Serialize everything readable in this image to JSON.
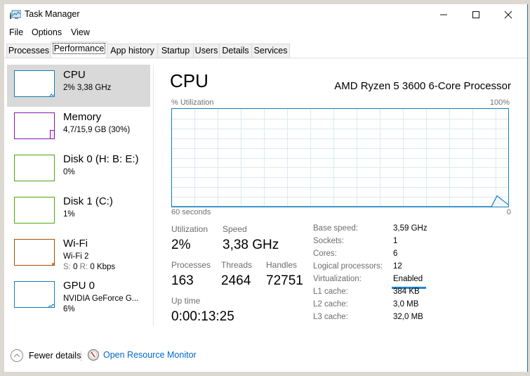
{
  "window": {
    "title": "Task Manager",
    "controls": {
      "minimize": "—",
      "maximize": "☐",
      "close": "✕"
    }
  },
  "menu": [
    "File",
    "Options",
    "View"
  ],
  "tabs": [
    {
      "label": "Processes",
      "active": false
    },
    {
      "label": "Performance",
      "active": true
    },
    {
      "label": "App history",
      "active": false
    },
    {
      "label": "Startup",
      "active": false
    },
    {
      "label": "Users",
      "active": false
    },
    {
      "label": "Details",
      "active": false
    },
    {
      "label": "Services",
      "active": false
    }
  ],
  "sidebar": {
    "items": [
      {
        "name": "CPU",
        "line1": "2% 3,38 GHz",
        "line2": "",
        "color": "#117dbb",
        "selected": true
      },
      {
        "name": "Memory",
        "line1": "4,7/15,9 GB (30%)",
        "line2": "",
        "color": "#8b12ae",
        "selected": false
      },
      {
        "name": "Disk 0 (H: B: E:)",
        "line1": "0%",
        "line2": "",
        "color": "#4da60c",
        "selected": false
      },
      {
        "name": "Disk 1 (C:)",
        "line1": "1%",
        "line2": "",
        "color": "#4da60c",
        "selected": false
      },
      {
        "name": "Wi-Fi",
        "line1": "Wi-Fi 2",
        "line2": "S: 0 R: 0 Kbps",
        "color": "#a74f01",
        "selected": false
      },
      {
        "name": "GPU 0",
        "line1": "NVIDIA GeForce G...",
        "line2": "6%",
        "color": "#117dbb",
        "selected": false
      }
    ]
  },
  "main": {
    "title": "CPU",
    "model": "AMD Ryzen 5 3600 6-Core Processor",
    "graph": {
      "ylabel": "% Utilization",
      "ymax_label": "100%",
      "xlabel_left": "60 seconds",
      "xlabel_right": "0",
      "accent": "#117dbb",
      "grid": "#d9eaf4"
    },
    "stats": {
      "utilization": {
        "label": "Utilization",
        "value": "2%"
      },
      "speed": {
        "label": "Speed",
        "value": "3,38 GHz"
      },
      "processes": {
        "label": "Processes",
        "value": "163"
      },
      "threads": {
        "label": "Threads",
        "value": "2464"
      },
      "handles": {
        "label": "Handles",
        "value": "72751"
      },
      "uptime": {
        "label": "Up time",
        "value": "0:00:13:25"
      }
    },
    "details": [
      {
        "label": "Base speed:",
        "value": "3,59 GHz"
      },
      {
        "label": "Sockets:",
        "value": "1"
      },
      {
        "label": "Cores:",
        "value": "6"
      },
      {
        "label": "Logical processors:",
        "value": "12"
      },
      {
        "label": "Virtualization:",
        "value": "Enabled"
      },
      {
        "label": "L1 cache:",
        "value": "384 KB"
      },
      {
        "label": "L2 cache:",
        "value": "3,0 MB"
      },
      {
        "label": "L3 cache:",
        "value": "32,0 MB"
      }
    ]
  },
  "chart_data": {
    "type": "area",
    "title": "CPU % Utilization",
    "xlabel": "60 seconds",
    "ylabel": "% Utilization",
    "xlim": [
      60,
      0
    ],
    "ylim": [
      0,
      100
    ],
    "grid": true,
    "x": [
      60,
      3,
      2,
      0
    ],
    "values": [
      0,
      0,
      11,
      2
    ]
  },
  "footer": {
    "fewer_details": "Fewer details",
    "resource_monitor": "Open Resource Monitor",
    "link_color": "#0066cc"
  }
}
